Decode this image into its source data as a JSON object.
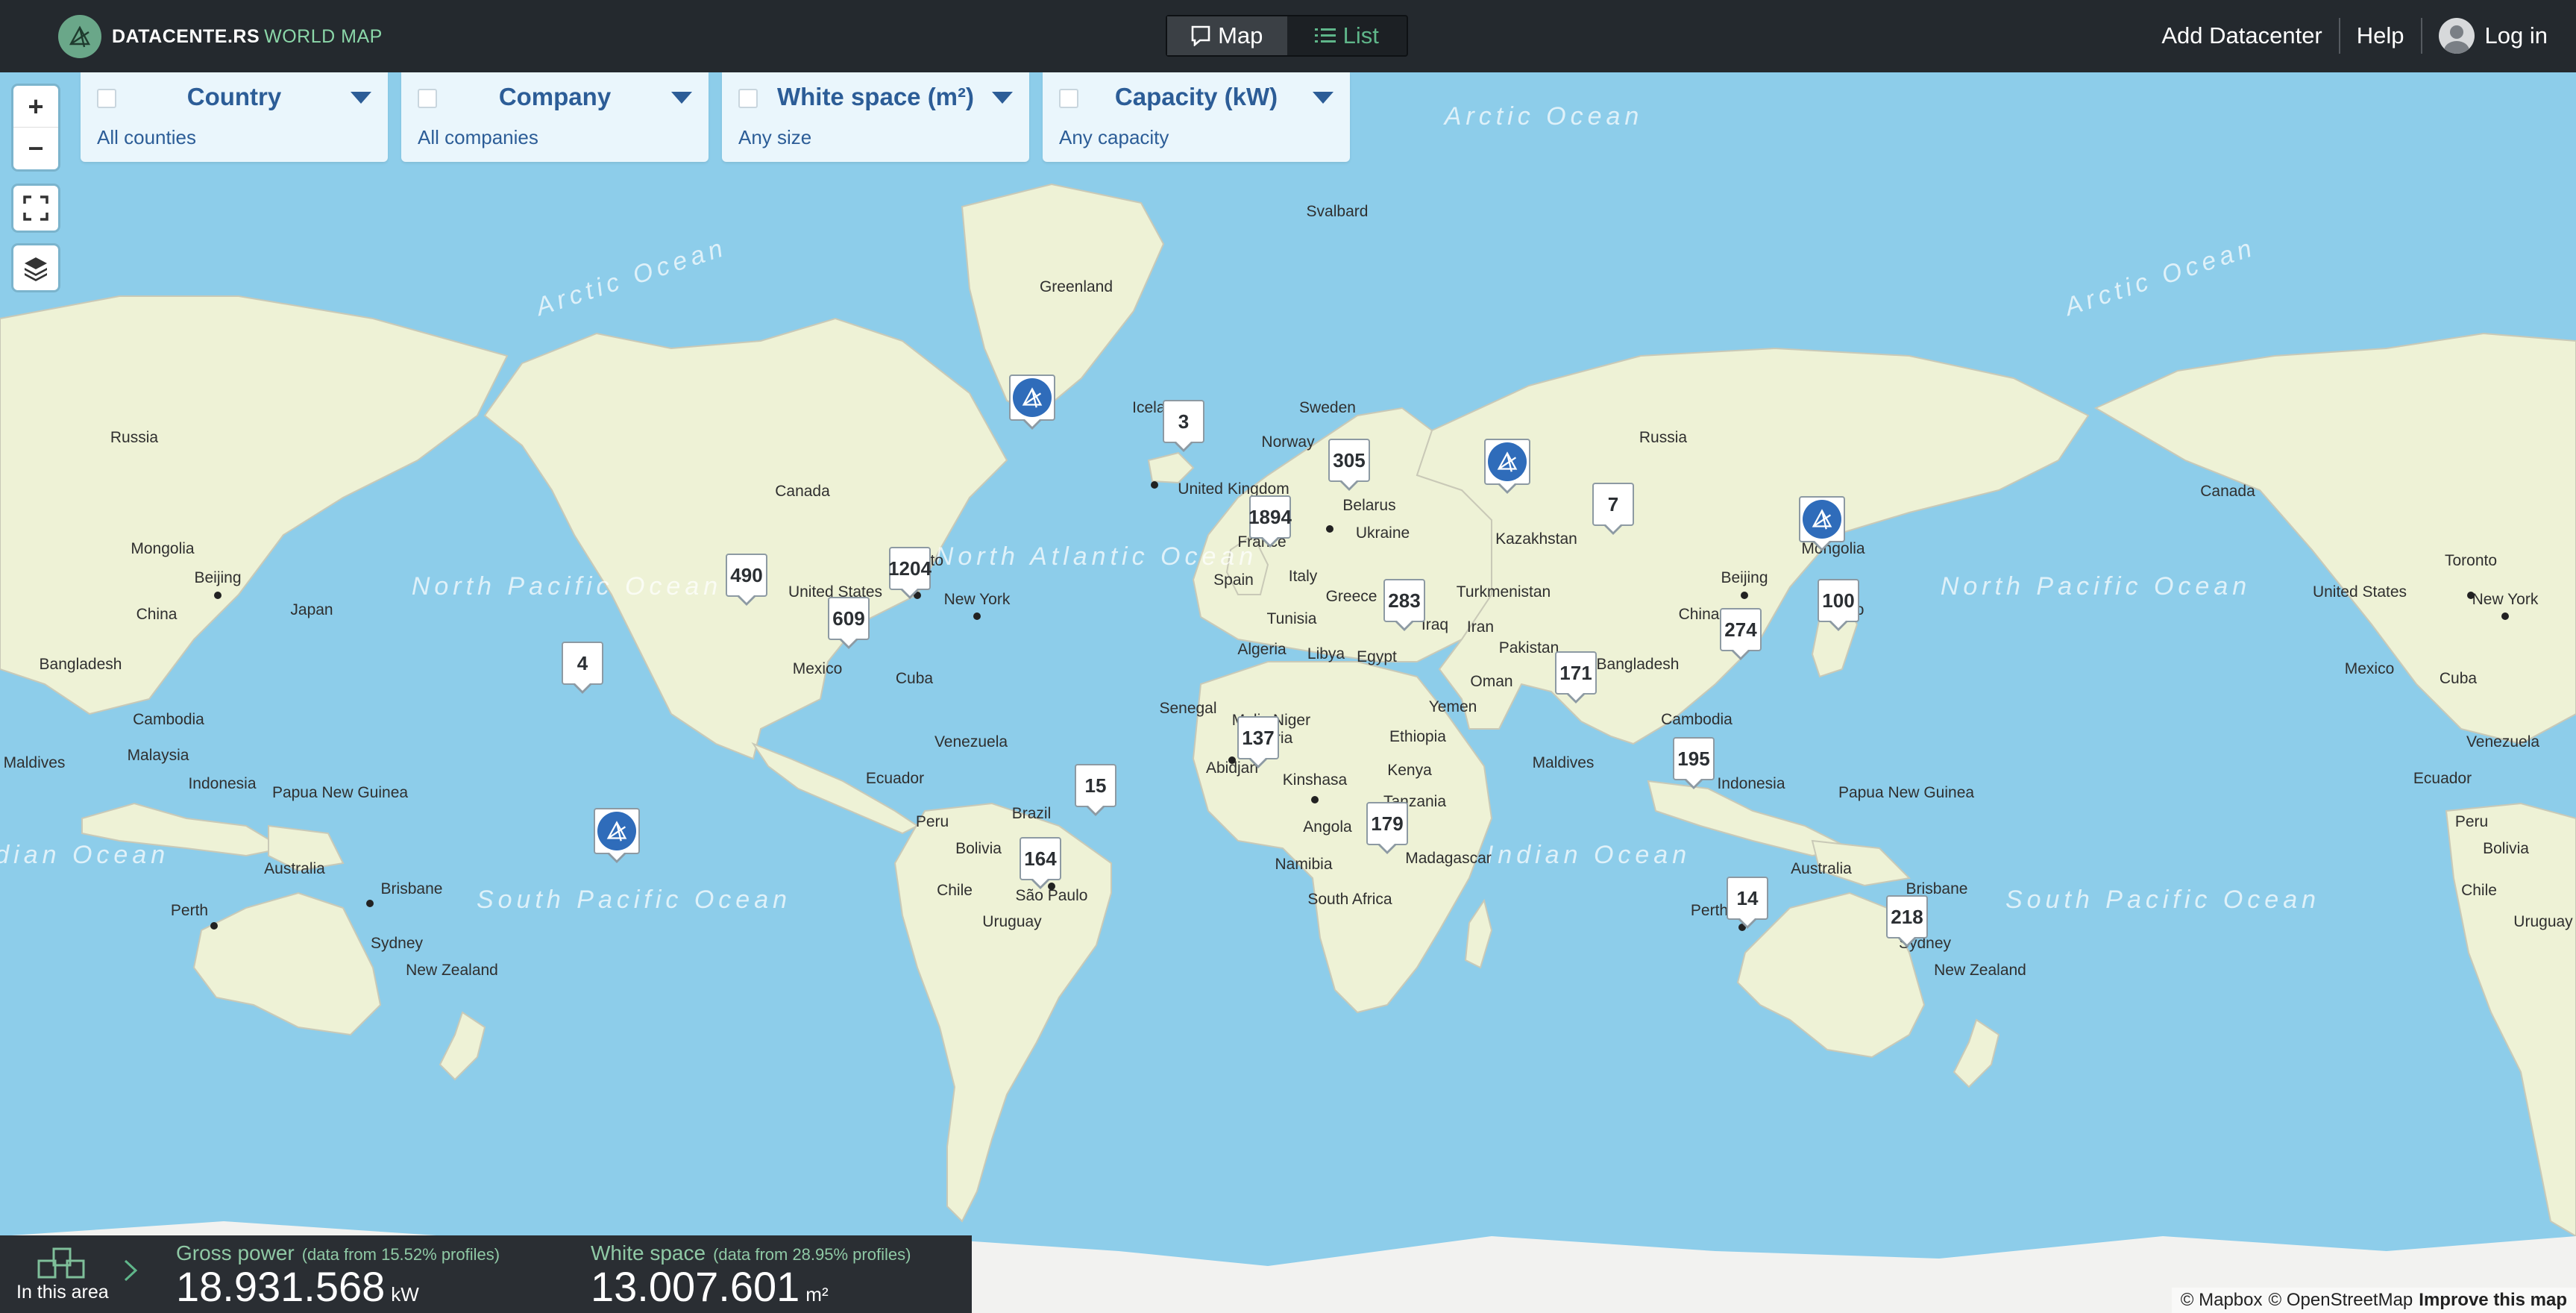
{
  "brand": {
    "name": "DATACENTE.RS",
    "accent": "WORLD MAP"
  },
  "mode_toggle": {
    "map_label": "Map",
    "list_label": "List",
    "active": "map"
  },
  "nav": {
    "add_label": "Add Datacenter",
    "help_label": "Help",
    "login_label": "Log in"
  },
  "controls": {
    "zoom_in": "+",
    "zoom_out": "−"
  },
  "filters": [
    {
      "title": "Country",
      "value": "All counties"
    },
    {
      "title": "Company",
      "value": "All companies"
    },
    {
      "title": "White space (m²)",
      "value": "Any size"
    },
    {
      "title": "Capacity (kW)",
      "value": "Any capacity"
    }
  ],
  "map_labels": {
    "oceans": [
      "Arctic Ocean",
      "Arctic Ocean",
      "Arctic Ocean",
      "North Pacific Ocean",
      "North Atlantic Ocean",
      "North Pacific Ocean",
      "South Pacific Ocean",
      "Indian Ocean",
      "Indian Ocean",
      "South Pacific Ocean"
    ],
    "places": [
      "Svalbard",
      "Greenland",
      "Russia",
      "Russia",
      "Canada",
      "Canada",
      "Mongolia",
      "Mongolia",
      "Beijing",
      "Beijing",
      "China",
      "China",
      "Japan",
      "Bangladesh",
      "Bangladesh",
      "Cambodia",
      "Cambodia",
      "Malaysia",
      "Maldives",
      "Maldives",
      "Indonesia",
      "Indonesia",
      "Papua New Guinea",
      "Papua New Guinea",
      "Australia",
      "Australia",
      "Perth",
      "Perth",
      "Brisbane",
      "Brisbane",
      "Sydney",
      "Sydney",
      "New Zealand",
      "New Zealand",
      "United States",
      "United States",
      "Toronto",
      "Toronto",
      "New York",
      "New York",
      "Mexico",
      "Mexico",
      "Cuba",
      "Cuba",
      "Venezuela",
      "Venezuela",
      "Ecuador",
      "Ecuador",
      "Peru",
      "Peru",
      "Brazil",
      "Bolivia",
      "Bolivia",
      "Chile",
      "Chile",
      "São Paulo",
      "Uruguay",
      "Uruguay",
      "Sweden",
      "Norway",
      "United Kingdom",
      "France",
      "Spain",
      "Italy",
      "Belarus",
      "Ukraine",
      "Kazakhstan",
      "Turkmenistan",
      "Greece",
      "Tunisia",
      "Algeria",
      "Libya",
      "Egypt",
      "Iraq",
      "Iran",
      "Oman",
      "Pakistan",
      "Yemen",
      "Senegal",
      "Mali",
      "Niger",
      "Nigeria",
      "Abidjan",
      "Ethiopia",
      "Kenya",
      "Kinshasa",
      "Tanzania",
      "Angola",
      "Namibia",
      "Madagascar",
      "South Africa",
      "Iceland",
      "Tokyo"
    ]
  },
  "markers": [
    {
      "type": "count",
      "label": "3"
    },
    {
      "type": "count",
      "label": "305"
    },
    {
      "type": "count",
      "label": "1894"
    },
    {
      "type": "count",
      "label": "7"
    },
    {
      "type": "count",
      "label": "490"
    },
    {
      "type": "count",
      "label": "1204"
    },
    {
      "type": "count",
      "label": "609"
    },
    {
      "type": "count",
      "label": "283"
    },
    {
      "type": "count",
      "label": "100"
    },
    {
      "type": "count",
      "label": "274"
    },
    {
      "type": "count",
      "label": "4"
    },
    {
      "type": "count",
      "label": "171"
    },
    {
      "type": "count",
      "label": "137"
    },
    {
      "type": "count",
      "label": "195"
    },
    {
      "type": "count",
      "label": "15"
    },
    {
      "type": "count",
      "label": "179"
    },
    {
      "type": "count",
      "label": "164"
    },
    {
      "type": "count",
      "label": "14"
    },
    {
      "type": "count",
      "label": "218"
    },
    {
      "type": "logo",
      "label": ""
    },
    {
      "type": "logo",
      "label": ""
    },
    {
      "type": "logo",
      "label": ""
    },
    {
      "type": "logo",
      "label": ""
    }
  ],
  "stats": {
    "area_label": "In this area",
    "gross_power_label": "Gross power",
    "gross_power_note": "(data from 15.52% profiles)",
    "gross_power_value": "18.931.568",
    "gross_power_unit": "kW",
    "white_space_label": "White space",
    "white_space_note": "(data from 28.95% profiles)",
    "white_space_value": "13.007.601",
    "white_space_unit": "m²"
  },
  "attribution": {
    "mapbox": "© Mapbox",
    "osm": "© OpenStreetMap",
    "improve": "Improve this map"
  },
  "colors": {
    "header": "#24292e",
    "water": "#8dcdea",
    "land": "#eef2d6",
    "accent_green": "#8bd7a9",
    "filter_text": "#2c5d97",
    "marker_logo": "#2f6cba"
  }
}
